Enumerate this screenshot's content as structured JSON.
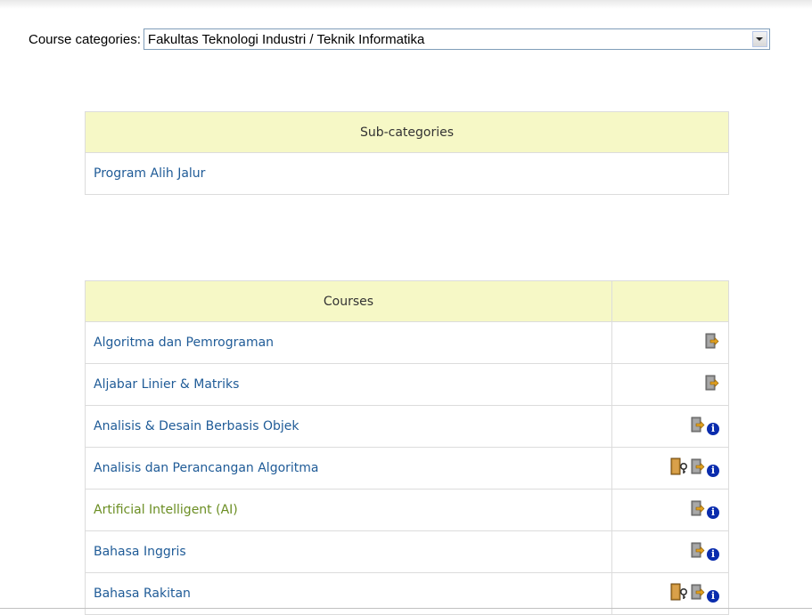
{
  "category_select": {
    "label": "Course categories:",
    "value": "Fakultas Teknologi Industri / Teknik Informatika"
  },
  "subcategories": {
    "header": "Sub-categories",
    "items": [
      {
        "label": "Program Alih Jalur"
      }
    ]
  },
  "courses": {
    "header": "Courses",
    "icons_header": "",
    "rows": [
      {
        "name": "Algoritma dan Pemrograman",
        "icons": [
          "guest-access-icon"
        ]
      },
      {
        "name": "Aljabar Linier & Matriks",
        "icons": [
          "guest-access-icon"
        ]
      },
      {
        "name": "Analisis & Desain Berbasis Objek",
        "icons": [
          "guest-access-icon",
          "info-icon"
        ]
      },
      {
        "name": "Analisis dan Perancangan Algoritma",
        "icons": [
          "enrolment-key-icon",
          "guest-access-icon",
          "info-icon"
        ]
      },
      {
        "name": "Artificial Intelligent (AI)",
        "dimmed": true,
        "icons": [
          "guest-access-icon",
          "info-icon"
        ]
      },
      {
        "name": "Bahasa Inggris",
        "icons": [
          "guest-access-icon",
          "info-icon"
        ]
      },
      {
        "name": "Bahasa Rakitan",
        "icons": [
          "enrolment-key-icon",
          "guest-access-icon",
          "info-icon"
        ]
      }
    ]
  },
  "colors": {
    "header_bg": "#f6f8c6",
    "link": "#1f5b97",
    "dimmed_link": "#6b8e23",
    "info_icon": "#0a2cad"
  }
}
